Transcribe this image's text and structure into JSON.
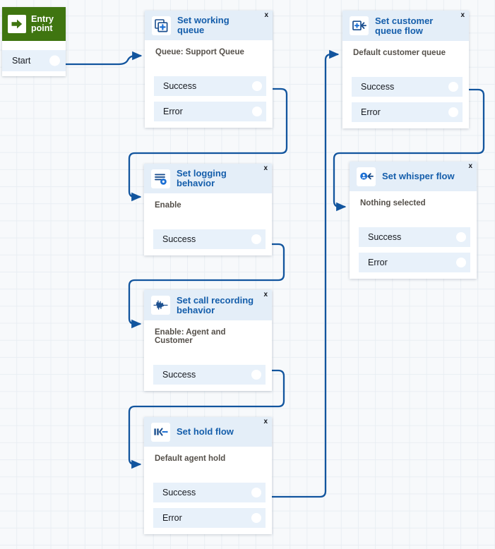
{
  "app": {
    "type": "contact-flow-designer",
    "canvas_background": "#f7f9fb",
    "grid_color": "#e9eef3",
    "accent_color": "#155eab",
    "connector_color": "#12559e",
    "entry_color": "#3f7510",
    "port_bg": "#e8f1fa",
    "header_bg": "#e4eef8"
  },
  "entry": {
    "title": "Entry\npoint",
    "icon": "arrow-right-icon",
    "ports": [
      {
        "label": "Start"
      }
    ]
  },
  "nodes": [
    {
      "id": "set-working-queue",
      "title": "Set working queue",
      "icon": "add-queue-icon",
      "close_label": "x",
      "description": "Queue: Support Queue",
      "ports": [
        {
          "label": "Success"
        },
        {
          "label": "Error"
        }
      ]
    },
    {
      "id": "set-customer-queue-flow",
      "title": "Set customer queue flow",
      "icon": "customer-queue-flow-icon",
      "close_label": "x",
      "description": "Default customer queue",
      "ports": [
        {
          "label": "Success"
        },
        {
          "label": "Error"
        }
      ]
    },
    {
      "id": "set-logging-behavior",
      "title": "Set logging behavior",
      "icon": "logging-gear-icon",
      "close_label": "x",
      "description": "Enable",
      "ports": [
        {
          "label": "Success"
        }
      ]
    },
    {
      "id": "set-whisper-flow",
      "title": "Set whisper flow",
      "icon": "whisper-flow-icon",
      "close_label": "x",
      "description": "Nothing selected",
      "ports": [
        {
          "label": "Success"
        },
        {
          "label": "Error"
        }
      ]
    },
    {
      "id": "set-call-recording-behavior",
      "title": "Set call recording behavior",
      "icon": "waveform-icon",
      "close_label": "x",
      "description": "Enable: Agent and Customer",
      "ports": [
        {
          "label": "Success"
        }
      ]
    },
    {
      "id": "set-hold-flow",
      "title": "Set hold flow",
      "icon": "hold-flow-icon",
      "close_label": "x",
      "description": "Default agent hold",
      "ports": [
        {
          "label": "Success"
        },
        {
          "label": "Error"
        }
      ]
    }
  ],
  "connections": [
    {
      "from": "entry.Start",
      "to": "set-working-queue"
    },
    {
      "from": "set-working-queue.Success",
      "to": "set-logging-behavior"
    },
    {
      "from": "set-logging-behavior.Success",
      "to": "set-call-recording-behavior"
    },
    {
      "from": "set-call-recording-behavior.Success",
      "to": "set-hold-flow"
    },
    {
      "from": "set-hold-flow.Success",
      "to": "set-customer-queue-flow"
    },
    {
      "from": "set-customer-queue-flow.Success",
      "to": "set-whisper-flow"
    }
  ]
}
